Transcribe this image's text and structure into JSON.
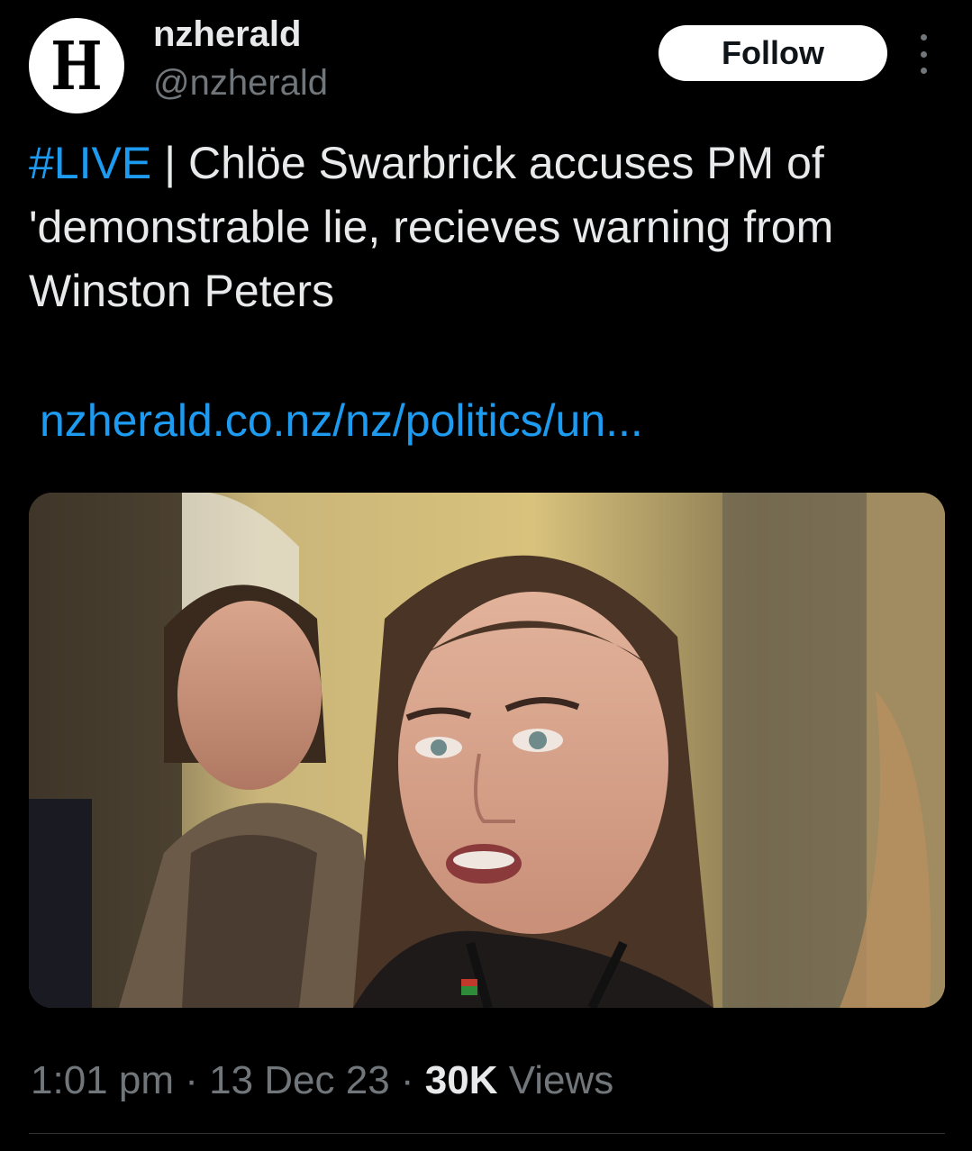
{
  "account": {
    "display_name": "nzherald",
    "handle": "@nzherald",
    "avatar_glyph": "H"
  },
  "actions": {
    "follow_label": "Follow",
    "more_icon": "more-vertical-icon"
  },
  "tweet": {
    "hashtag": "#LIVE",
    "text": " | Chlöe Swarbrick accuses PM of 'demonstrable lie, recieves warning from Winston Peters",
    "link": "nzherald.co.nz/nz/politics/un..."
  },
  "meta": {
    "time": "1:01 pm",
    "separator1": " · ",
    "date": "13 Dec 23",
    "separator2": " · ",
    "views_count": "30K",
    "views_label": " Views"
  },
  "colors": {
    "background": "#000000",
    "accent": "#1d9bf0",
    "text_primary": "#e7e9ea",
    "text_secondary": "#71767b"
  }
}
